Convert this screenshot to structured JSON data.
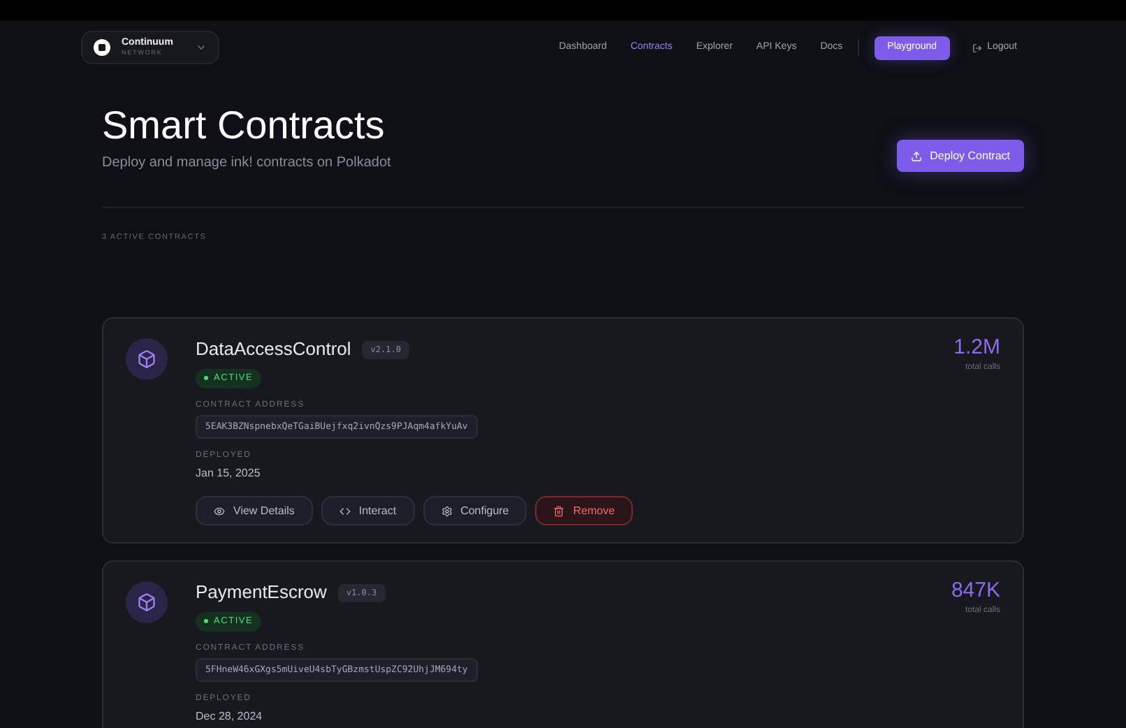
{
  "brand": {
    "name": "Continuum",
    "tagline": "NETWORK"
  },
  "nav": [
    {
      "label": "Dashboard",
      "selected": false
    },
    {
      "label": "Contracts",
      "selected": true
    },
    {
      "label": "Explorer",
      "selected": false
    },
    {
      "label": "API Keys",
      "selected": false
    },
    {
      "label": "Docs",
      "selected": false
    }
  ],
  "playground_button": "Playground",
  "logout": "Logout",
  "page": {
    "title": "Smart Contracts",
    "subtitle": "Deploy and manage ink! contracts on Polkadot",
    "deploy_button": "Deploy Contract",
    "count_label": "3 ACTIVE CONTRACTS"
  },
  "contracts": [
    {
      "name": "DataAccessControl",
      "version": "v2.1.0",
      "status": "ACTIVE",
      "address_label": "CONTRACT ADDRESS",
      "address": "5EAK3BZNspnebxQeTGaiBUejfxq2ivnQzs9PJAqm4afkYuAv",
      "deployed_label": "DEPLOYED",
      "deployed": "Jan 15, 2025",
      "calls": "1.2M",
      "calls_label": "total calls",
      "actions": [
        {
          "kind": "view",
          "label": "View Details"
        },
        {
          "kind": "code",
          "label": "Interact"
        },
        {
          "kind": "settings",
          "label": "Configure"
        },
        {
          "kind": "delete",
          "label": "Remove"
        }
      ]
    },
    {
      "name": "PaymentEscrow",
      "version": "v1.0.3",
      "status": "ACTIVE",
      "address_label": "CONTRACT ADDRESS",
      "address": "5FHneW46xGXgs5mUiveU4sbTyGBzmstUspZC92UhjJM694ty",
      "deployed_label": "DEPLOYED",
      "deployed": "Dec 28, 2024",
      "calls": "847K",
      "calls_label": "total calls"
    }
  ]
}
